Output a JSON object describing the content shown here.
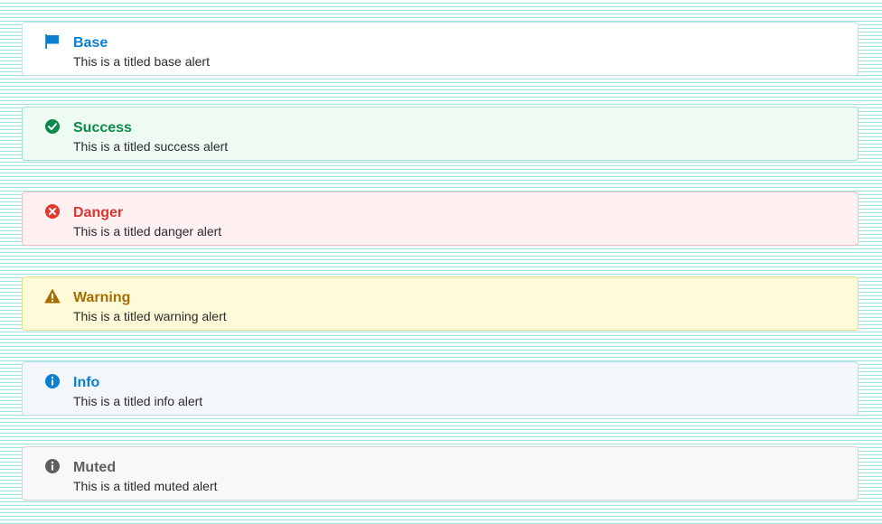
{
  "alerts": [
    {
      "key": "base",
      "title": "Base",
      "message": "This is a titled base alert",
      "icon": "flag-icon",
      "accent": "#0a7fd1"
    },
    {
      "key": "success",
      "title": "Success",
      "message": "This is a titled success alert",
      "icon": "check-circle-icon",
      "accent": "#0c8a4b"
    },
    {
      "key": "danger",
      "title": "Danger",
      "message": "This is a titled danger alert",
      "icon": "x-circle-icon",
      "accent": "#e0382f"
    },
    {
      "key": "warning",
      "title": "Warning",
      "message": "This is a titled warning alert",
      "icon": "warning-triangle-icon",
      "accent": "#a86d00"
    },
    {
      "key": "info",
      "title": "Info",
      "message": "This is a titled info alert",
      "icon": "info-circle-icon",
      "accent": "#0a7fd1"
    },
    {
      "key": "muted",
      "title": "Muted",
      "message": "This is a titled muted alert",
      "icon": "info-circle-icon",
      "accent": "#5f5f5f"
    }
  ]
}
